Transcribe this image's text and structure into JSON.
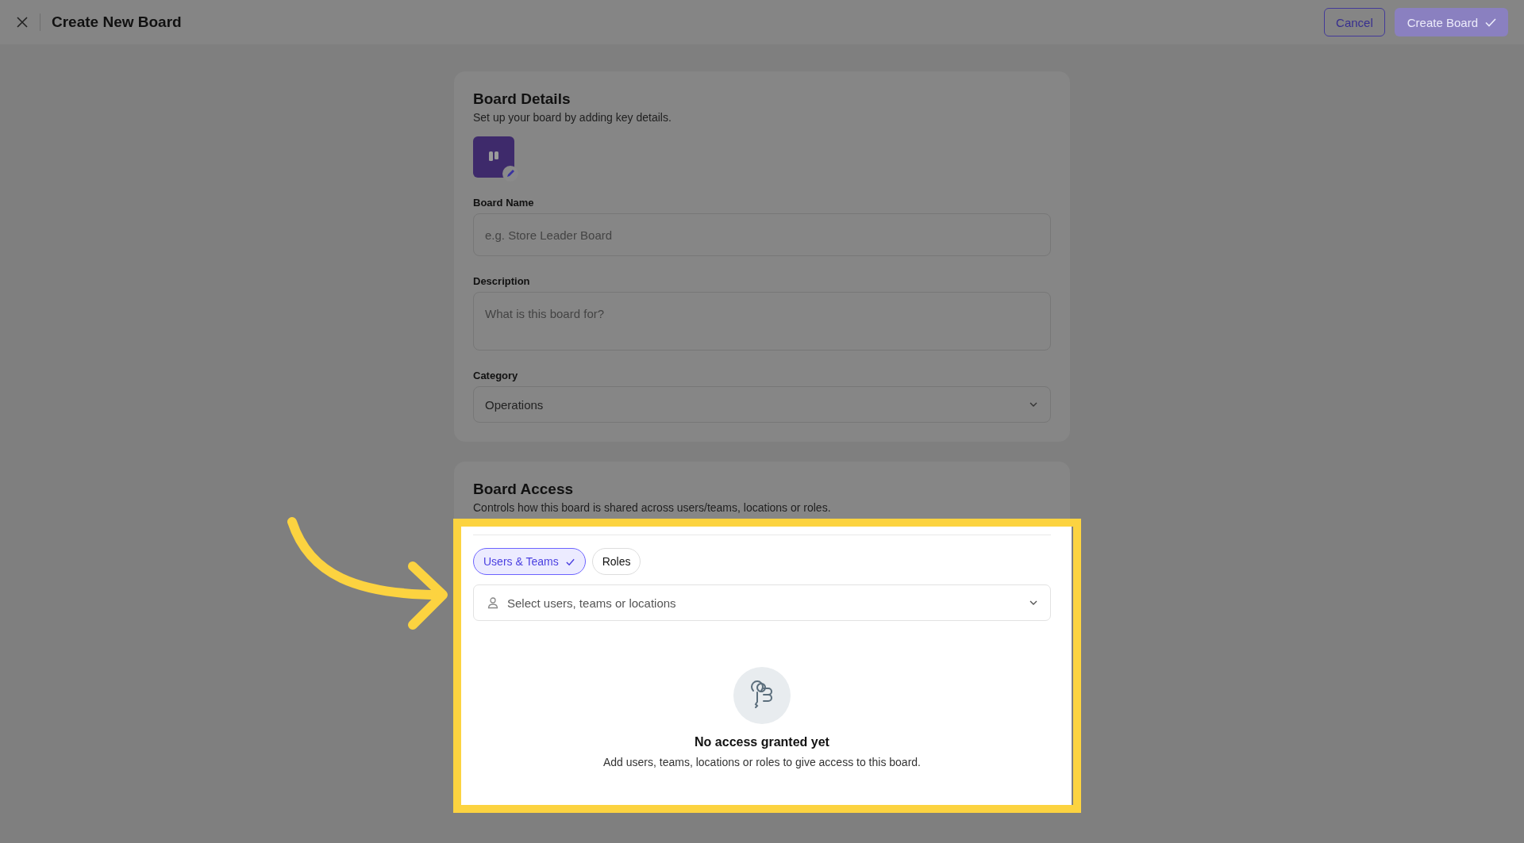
{
  "header": {
    "title": "Create New Board",
    "buttons": [
      {
        "label": "Cancel",
        "kind": "secondary",
        "disabled": false
      },
      {
        "label": "Create Board",
        "kind": "primary",
        "disabled": true
      }
    ]
  },
  "board_details": {
    "title": "Board Details",
    "subtitle": "Set up your board by adding key details.",
    "fields": [
      {
        "kind": "text",
        "label": "Board Name",
        "placeholder": "e.g. Store Leader Board"
      },
      {
        "kind": "textarea",
        "label": "Description",
        "placeholder": "What is this board for?"
      },
      {
        "kind": "select",
        "label": "Category",
        "value": "Operations"
      }
    ]
  },
  "board_access": {
    "title": "Board Access",
    "subtitle": "Controls how this board is shared across users/teams, locations or roles.",
    "tabs": [
      {
        "label": "Users & Teams",
        "selected": true
      },
      {
        "label": "Roles",
        "selected": false
      }
    ],
    "picker": {
      "placeholder": "Select users, teams or locations"
    },
    "empty_state": {
      "title": "No access granted yet",
      "message": "Add users, teams, locations or roles to give access to this board."
    }
  }
}
